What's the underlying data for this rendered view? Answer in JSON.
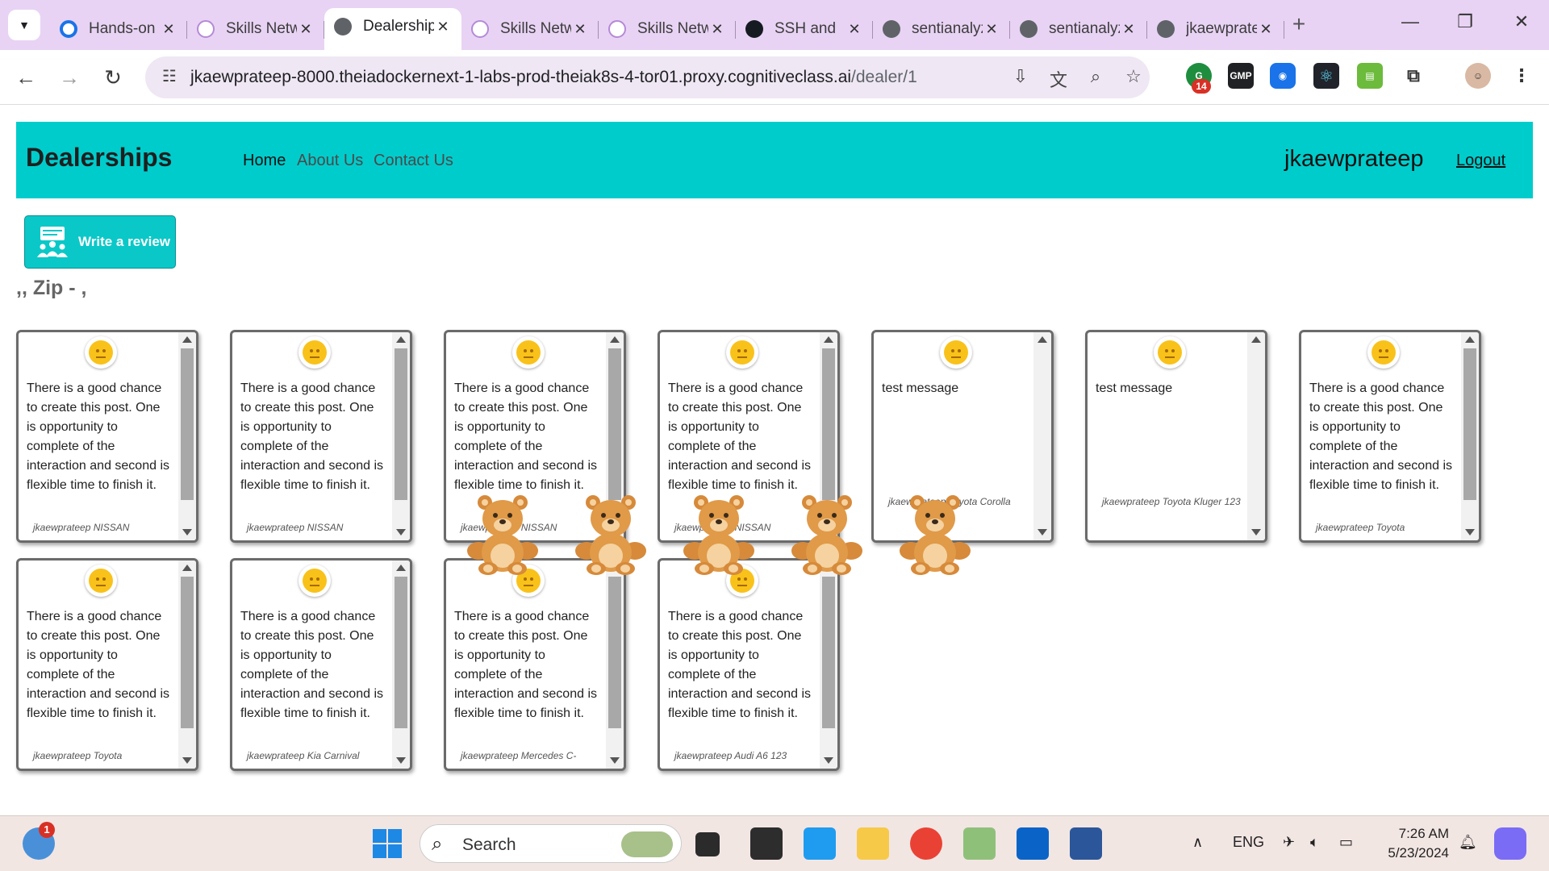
{
  "browser": {
    "tabs": [
      {
        "title": "Hands-on",
        "favicon": "google-icon"
      },
      {
        "title": "Skills Network",
        "favicon": "skills-network-icon"
      },
      {
        "title": "Dealerships",
        "favicon": "globe-icon",
        "active": true
      },
      {
        "title": "Skills Network",
        "favicon": "skills-network-icon"
      },
      {
        "title": "Skills Network",
        "favicon": "skills-network-icon"
      },
      {
        "title": "SSH and",
        "favicon": "github-icon"
      },
      {
        "title": "sentianalyzer",
        "favicon": "globe-icon"
      },
      {
        "title": "sentianalyzer",
        "favicon": "globe-icon"
      },
      {
        "title": "jkaewprateep",
        "favicon": "globe-icon"
      }
    ],
    "address": {
      "host": "jkaewprateep-8000.theiadockernext-1-labs-prod-theiak8s-4-tor01.proxy.cognitiveclass.ai",
      "path": "/dealer/1"
    },
    "extension_badge": "14",
    "new_tab_label": "+"
  },
  "navbar": {
    "brand": "Dealerships",
    "links": [
      "Home",
      "About Us",
      "Contact Us"
    ],
    "username": "jkaewprateep",
    "logout": "Logout"
  },
  "actions": {
    "write_review": "Write a review"
  },
  "dealer": {
    "address_line": ",, Zip - ,"
  },
  "reviews": [
    {
      "text": "There is a good chance to create this post. One is opportunity to complete of the interaction and second is flexible time to finish it.",
      "meta": "jkaewprateep NISSAN"
    },
    {
      "text": "There is a good chance to create this post. One is opportunity to complete of the interaction and second is flexible time to finish it.",
      "meta": "jkaewprateep NISSAN"
    },
    {
      "text": "There is a good chance to create this post. One is opportunity to complete of the interaction and second is flexible time to finish it.",
      "meta": "jkaewprateep NISSAN"
    },
    {
      "text": "There is a good chance to create this post. One is opportunity to complete of the interaction and second is flexible time to finish it.",
      "meta": "jkaewprateep NISSAN"
    },
    {
      "text": "test message",
      "meta": "jkaewprateep Toyota Corolla"
    },
    {
      "text": "test message",
      "meta": "jkaewprateep Toyota Kluger 123"
    },
    {
      "text": "There is a good chance to create this post. One is opportunity to complete of the interaction and second is flexible time to finish it.",
      "meta": "jkaewprateep Toyota"
    },
    {
      "text": "There is a good chance to create this post. One is opportunity to complete of the interaction and second is flexible time to finish it.",
      "meta": "jkaewprateep Toyota"
    },
    {
      "text": "There is a good chance to create this post. One is opportunity to complete of the interaction and second is flexible time to finish it.",
      "meta": "jkaewprateep Kia Carnival"
    },
    {
      "text": "There is a good chance to create this post. One is opportunity to complete of the interaction and second is flexible time to finish it.",
      "meta": "jkaewprateep Mercedes C-"
    },
    {
      "text": "There is a good chance to create this post. One is opportunity to complete of the interaction and second is flexible time to finish it.",
      "meta": "jkaewprateep Audi A6 123"
    }
  ],
  "taskbar": {
    "search_placeholder": "Search",
    "notification_badge": "1",
    "language": "ENG",
    "time": "7:26 AM",
    "date": "5/23/2024"
  },
  "colors": {
    "tabstrip": "#e8d3f4",
    "navbar": "#00cccc",
    "button": "#0ac8c8",
    "emoji": "#f9c21a"
  }
}
